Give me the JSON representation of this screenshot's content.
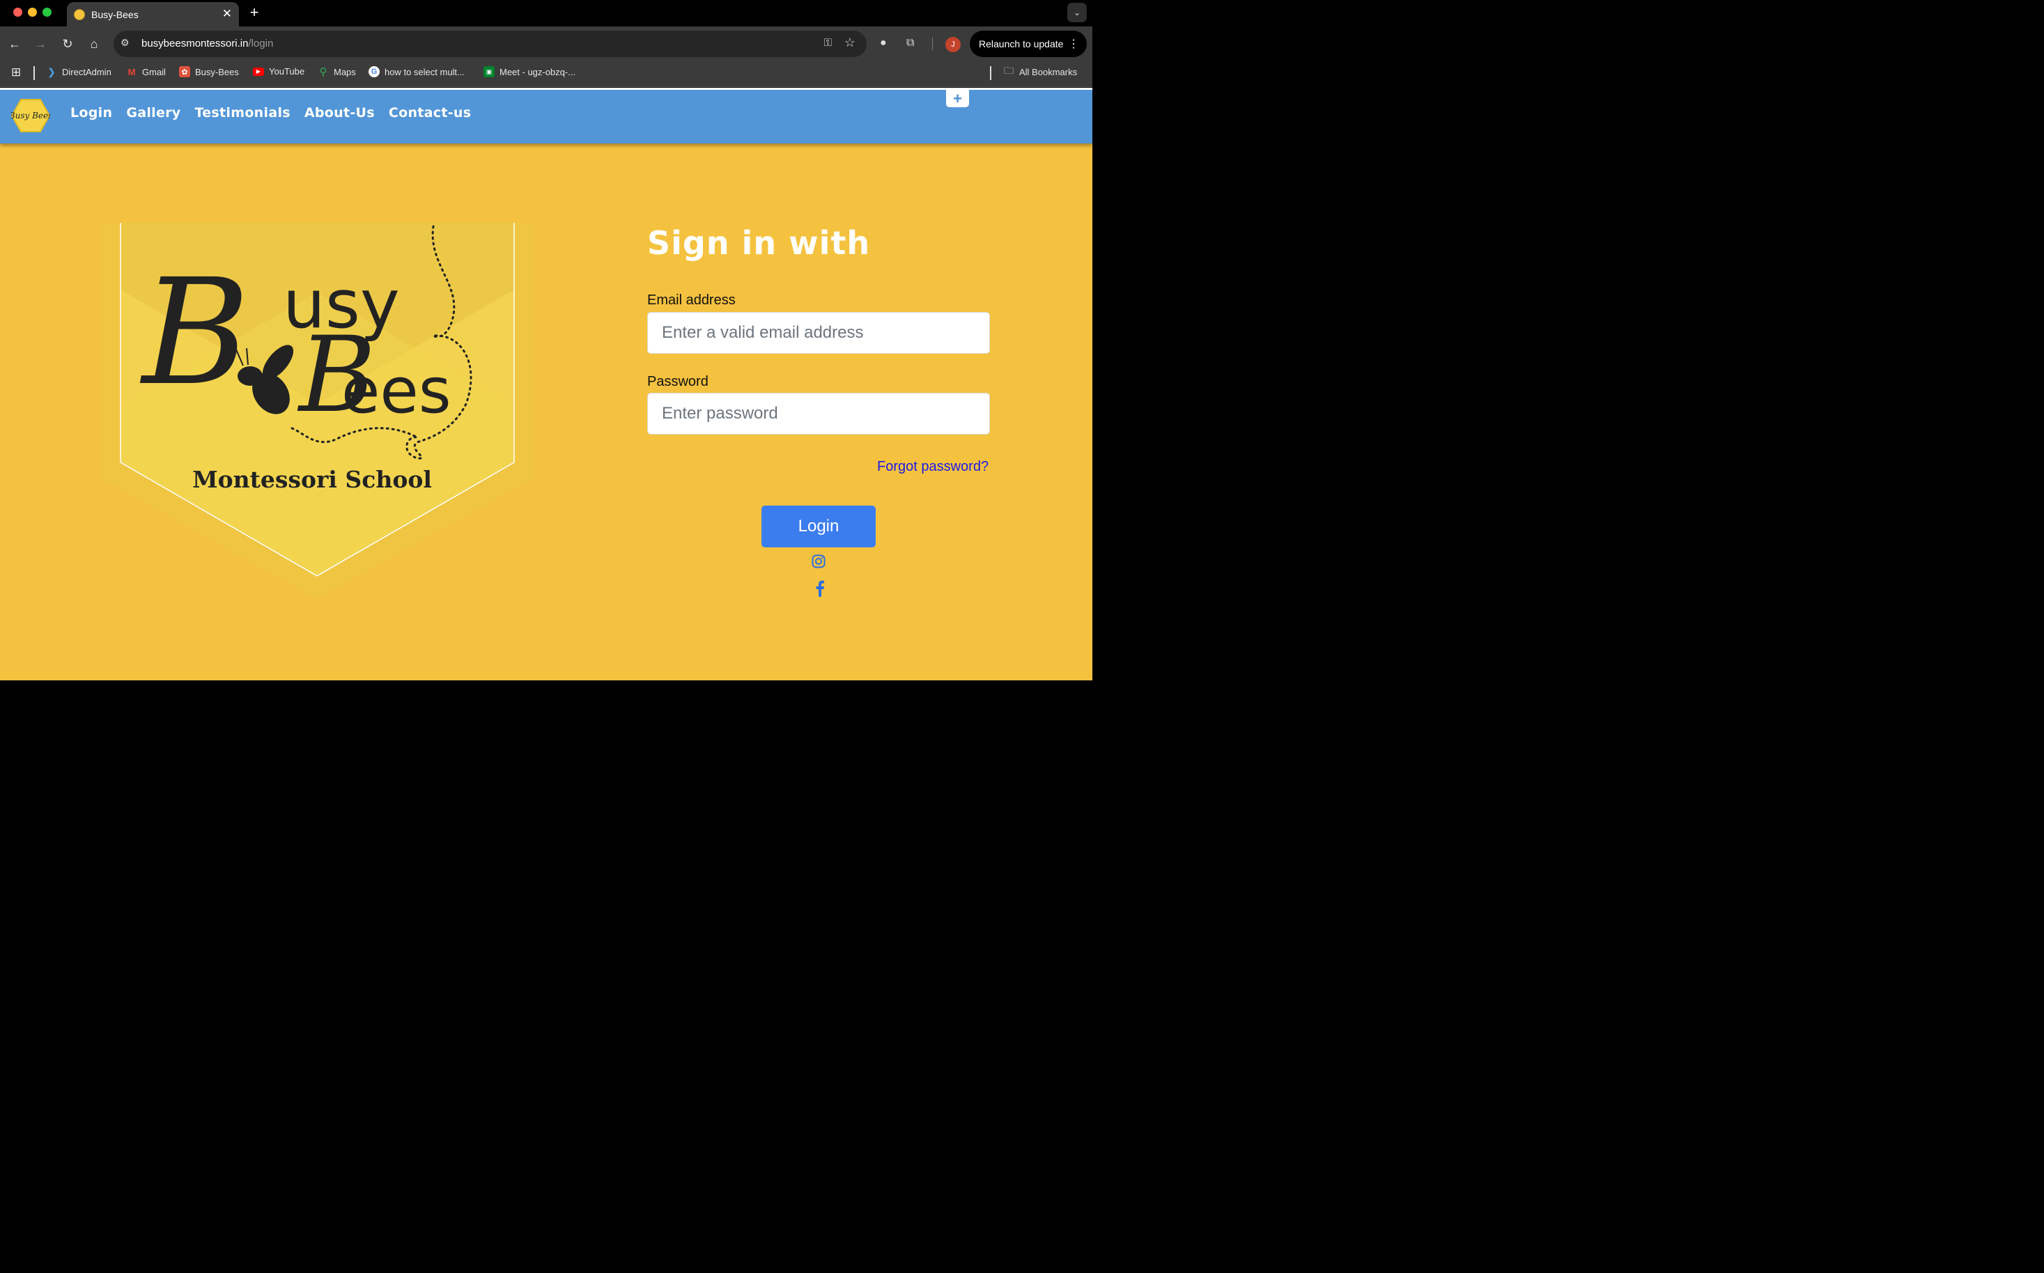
{
  "browser": {
    "tab_title": "Busy-Bees",
    "tab_close": "✕",
    "new_tab": "+",
    "url_host": "busybeesmontessori.in",
    "url_path": "/login",
    "avatar_initial": "J",
    "relaunch_label": "Relaunch to update",
    "bookmarks": [
      {
        "label": "DirectAdmin",
        "icon": "directadmin-icon"
      },
      {
        "label": "Gmail",
        "icon": "gmail-icon"
      },
      {
        "label": "Busy-Bees",
        "icon": "busybees-favicon"
      },
      {
        "label": "YouTube",
        "icon": "youtube-icon"
      },
      {
        "label": "Maps",
        "icon": "maps-icon"
      },
      {
        "label": "how to select mult...",
        "icon": "google-icon"
      },
      {
        "label": "Meet - ugz-obzq-...",
        "icon": "meet-icon"
      }
    ],
    "all_bookmarks": "All Bookmarks"
  },
  "nav": {
    "links": [
      "Login",
      "Gallery",
      "Testimonials",
      "About-Us",
      "Contact-us"
    ],
    "plus": "+",
    "logo_text": "Busy Bees"
  },
  "hero": {
    "brand_text": "Busy Bees",
    "subtitle": "Montessori School"
  },
  "form": {
    "heading": "Sign in with",
    "email_label": "Email address",
    "email_placeholder": "Enter a valid email address",
    "password_label": "Password",
    "password_placeholder": "Enter password",
    "forgot": "Forgot password?",
    "login_button": "Login"
  },
  "colors": {
    "page_bg": "#f5c23f",
    "navbar": "#5296d8",
    "button": "#3b7def",
    "link": "#1a1ae6"
  }
}
